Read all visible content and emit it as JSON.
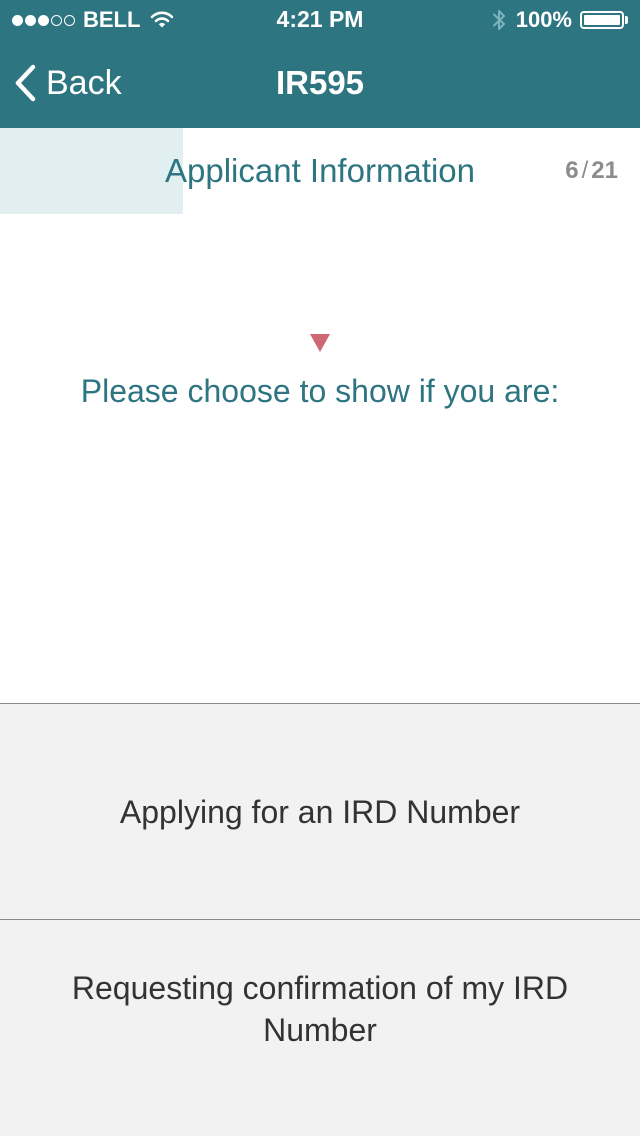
{
  "status_bar": {
    "carrier": "BELL",
    "time": "4:21 PM",
    "battery_percent": "100%",
    "signal_bars_filled": 3,
    "signal_bars_total": 5,
    "icons": [
      "wifi-icon",
      "bluetooth-icon",
      "battery-icon"
    ]
  },
  "nav": {
    "back_label": "Back",
    "title": "IR595",
    "back_icon": "chevron-left-icon"
  },
  "section": {
    "title": "Applicant Information",
    "step_current": "6",
    "step_separator": "/",
    "step_total": "21",
    "progress_fraction": 0.2857
  },
  "question": {
    "text": "Please choose to show if you are:"
  },
  "options": [
    {
      "label": "Applying for an IRD Number"
    },
    {
      "label": "Requesting confirmation of my IRD Number"
    }
  ],
  "colors": {
    "brand": "#2e7582",
    "progress_fill": "#e1eff0",
    "accent": "#cf6775",
    "option_bg": "#f2f2f2",
    "option_text": "#333333",
    "muted": "#8c8c8c"
  }
}
